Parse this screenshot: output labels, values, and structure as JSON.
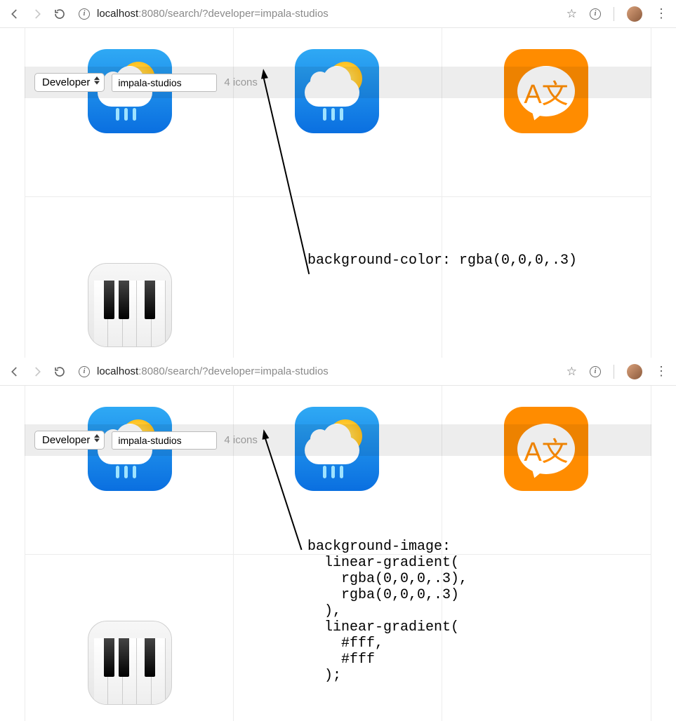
{
  "browser": {
    "host": "localhost",
    "port": ":8080",
    "path": "/search/?developer=impala-studios"
  },
  "filter": {
    "select_label": "Developer",
    "input_value": "impala-studios",
    "count_text": "4 icons"
  },
  "annotations": {
    "top": "background-color: rgba(0,0,0,.3)",
    "bottom": "background-image:\n  linear-gradient(\n    rgba(0,0,0,.3),\n    rgba(0,0,0,.3)\n  ),\n  linear-gradient(\n    #fff,\n    #fff\n  );"
  },
  "icons": {
    "weather_name": "weather-app-icon",
    "translate_name": "translate-app-icon",
    "piano_name": "piano-app-icon",
    "translate_glyph": "A文"
  }
}
